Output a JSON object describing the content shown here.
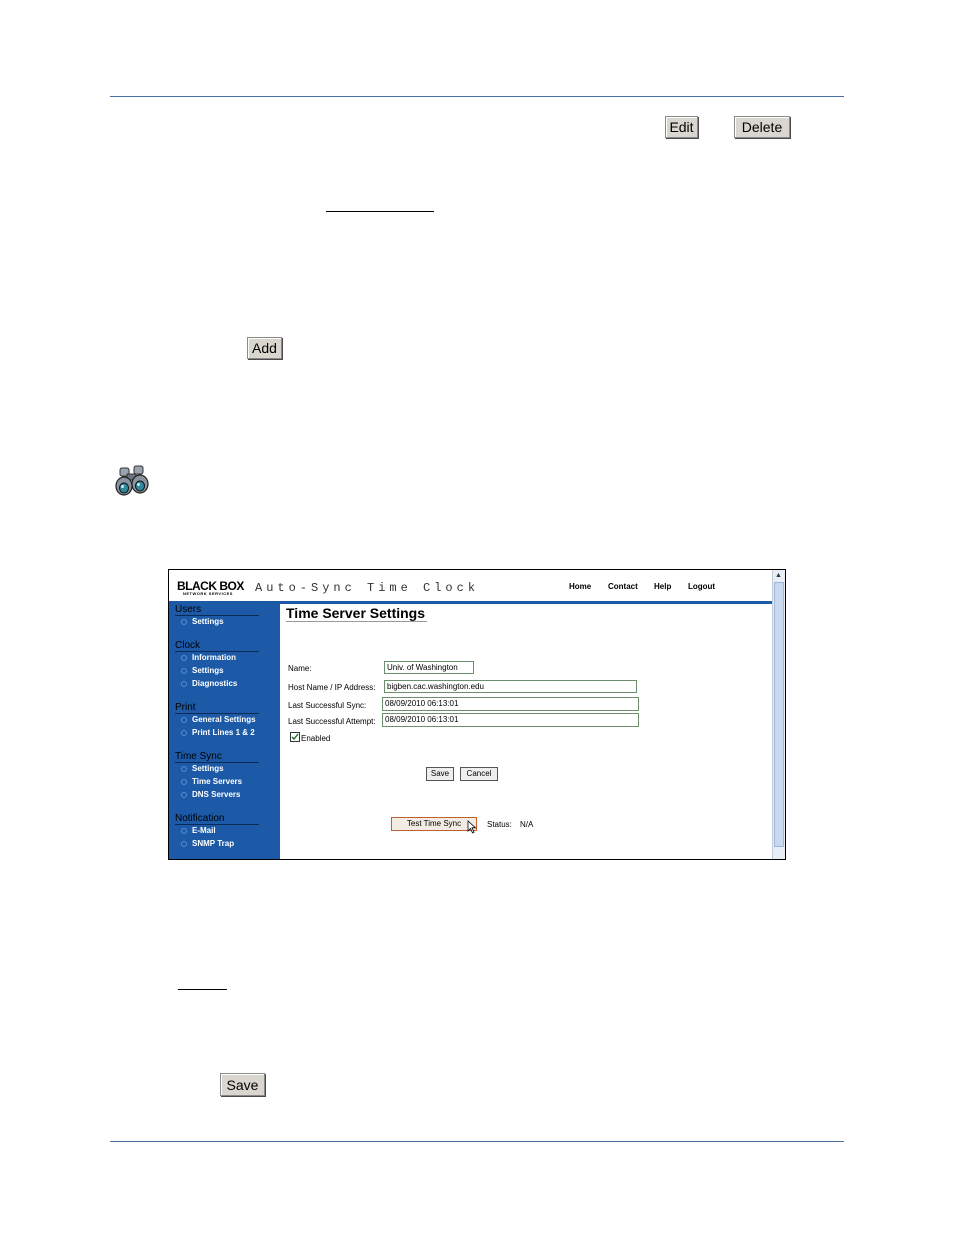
{
  "buttons": {
    "edit": "Edit",
    "delete": "Delete",
    "add": "Add",
    "save": "Save"
  },
  "screenshot": {
    "logo": "BLACK BOX",
    "logo_sub": "NETWORK SERVICES",
    "app_title": "Auto-Sync Time Clock",
    "nav": [
      "Home",
      "Contact",
      "Help",
      "Logout"
    ],
    "sidebar": {
      "users": {
        "title": "Users",
        "items": [
          "Settings"
        ]
      },
      "clock": {
        "title": "Clock",
        "items": [
          "Information",
          "Settings",
          "Diagnostics"
        ]
      },
      "print": {
        "title": "Print",
        "items": [
          "General Settings",
          "Print Lines 1 & 2"
        ]
      },
      "time_sync": {
        "title": "Time Sync",
        "items": [
          "Settings",
          "Time Servers",
          "DNS Servers"
        ]
      },
      "notification": {
        "title": "Notification",
        "items": [
          "E-Mail",
          "SNMP Trap"
        ]
      }
    },
    "page_title": "Time Server Settings",
    "form": {
      "name_label": "Name:",
      "name_value": "Univ. of Washington",
      "host_label": "Host Name / IP Address:",
      "host_value": "bigben.cac.washington.edu",
      "last_sync_label": "Last Successful Sync:",
      "last_sync_value": "08/09/2010 06:13:01",
      "last_attempt_label": "Last Successful Attempt:",
      "last_attempt_value": "08/09/2010 06:13:01",
      "enabled_label": "Enabled",
      "enabled": true,
      "save": "Save",
      "cancel": "Cancel",
      "test": "Test Time Sync",
      "status_label": "Status:",
      "status_value": "N/A"
    }
  }
}
